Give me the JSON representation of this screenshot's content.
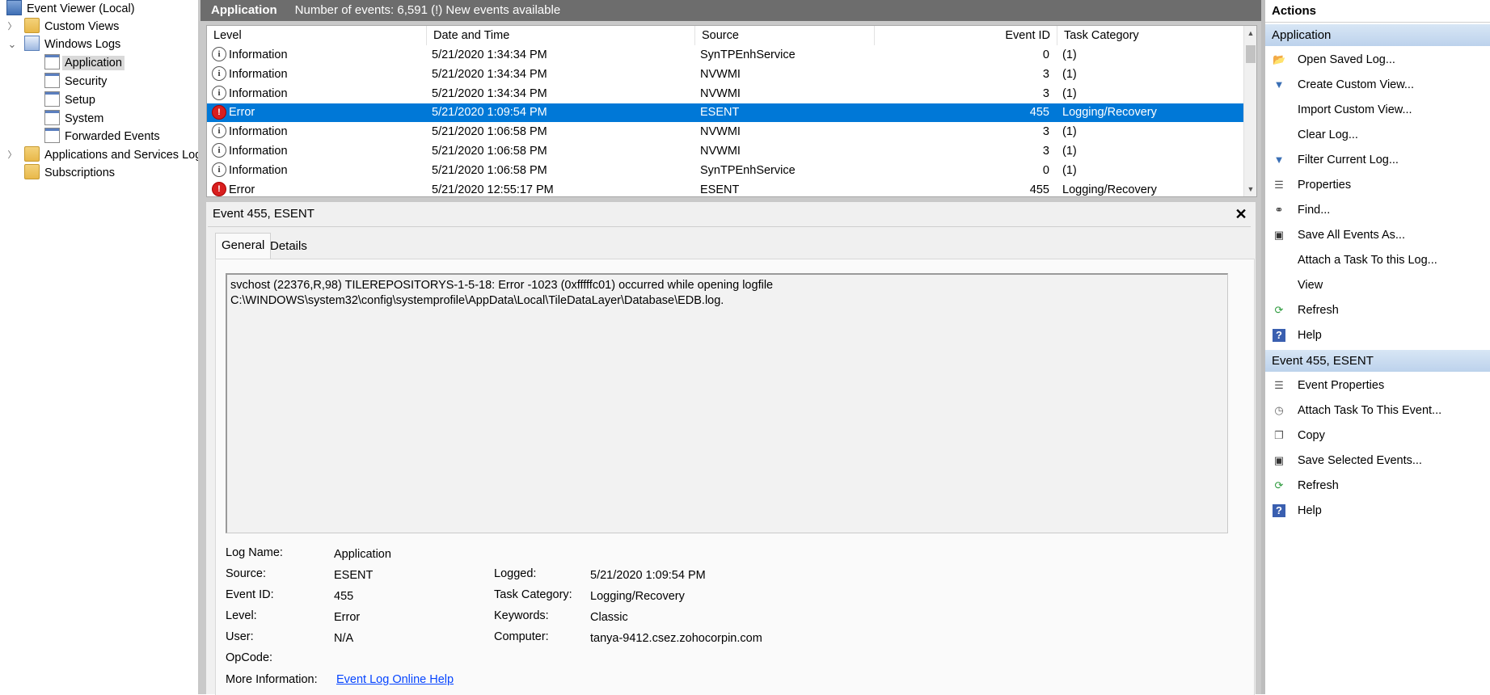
{
  "tree": {
    "items": [
      {
        "label": "Event Viewer (Local)",
        "icon": "event-viewer-icon",
        "expander": ""
      },
      {
        "label": "Custom Views",
        "icon": "folder-icon",
        "expander": "›"
      },
      {
        "label": "Windows Logs",
        "icon": "computer-folder-icon",
        "expander": "⌄"
      },
      {
        "label": "Application",
        "icon": "log-icon",
        "expander": ""
      },
      {
        "label": "Security",
        "icon": "log-icon",
        "expander": ""
      },
      {
        "label": "Setup",
        "icon": "log-icon",
        "expander": ""
      },
      {
        "label": "System",
        "icon": "log-icon",
        "expander": ""
      },
      {
        "label": "Forwarded Events",
        "icon": "log-icon",
        "expander": ""
      },
      {
        "label": "Applications and Services Log",
        "icon": "folder-icon",
        "expander": "›"
      },
      {
        "label": "Subscriptions",
        "icon": "subscriptions-icon",
        "expander": ""
      }
    ]
  },
  "center": {
    "title": "Application",
    "count_text": "Number of events: 6,591 (!) New events available"
  },
  "grid": {
    "columns": [
      "Level",
      "Date and Time",
      "Source",
      "Event ID",
      "Task Category"
    ],
    "rows": [
      {
        "level": "Information",
        "icon": "i",
        "date": "5/21/2020 1:34:34 PM",
        "source": "SynTPEnhService",
        "id": "0",
        "category": "(1)"
      },
      {
        "level": "Information",
        "icon": "i",
        "date": "5/21/2020 1:34:34 PM",
        "source": "NVWMI",
        "id": "3",
        "category": "(1)"
      },
      {
        "level": "Information",
        "icon": "i",
        "date": "5/21/2020 1:34:34 PM",
        "source": "NVWMI",
        "id": "3",
        "category": "(1)"
      },
      {
        "level": "Error",
        "icon": "!",
        "date": "5/21/2020 1:09:54 PM",
        "source": "ESENT",
        "id": "455",
        "category": "Logging/Recovery"
      },
      {
        "level": "Information",
        "icon": "i",
        "date": "5/21/2020 1:06:58 PM",
        "source": "NVWMI",
        "id": "3",
        "category": "(1)"
      },
      {
        "level": "Information",
        "icon": "i",
        "date": "5/21/2020 1:06:58 PM",
        "source": "NVWMI",
        "id": "3",
        "category": "(1)"
      },
      {
        "level": "Information",
        "icon": "i",
        "date": "5/21/2020 1:06:58 PM",
        "source": "SynTPEnhService",
        "id": "0",
        "category": "(1)"
      },
      {
        "level": "Error",
        "icon": "!",
        "date": "5/21/2020 12:55:17 PM",
        "source": "ESENT",
        "id": "455",
        "category": "Logging/Recovery"
      }
    ],
    "selected_row": 3
  },
  "detail": {
    "title": "Event 455, ESENT",
    "close": "✕",
    "tabs": [
      "General",
      "Details"
    ],
    "message": "svchost (22376,R,98) TILEREPOSITORYS-1-5-18: Error -1023 (0xfffffc01) occurred while opening logfile C:\\WINDOWS\\system32\\config\\systemprofile\\AppData\\Local\\TileDataLayer\\Database\\EDB.log.",
    "fields": {
      "log_name_label": "Log Name:",
      "log_name": "Application",
      "source_label": "Source:",
      "source": "ESENT",
      "event_id_label": "Event ID:",
      "event_id": "455",
      "level_label": "Level:",
      "level": "Error",
      "user_label": "User:",
      "user": "N/A",
      "opcode_label": "OpCode:",
      "opcode": "",
      "more_info_label": "More Information:",
      "more_info_link": "Event Log Online Help",
      "logged_label": "Logged:",
      "logged": "5/21/2020 1:09:54 PM",
      "task_label": "Task Category:",
      "task": "Logging/Recovery",
      "keywords_label": "Keywords:",
      "keywords": "Classic",
      "computer_label": "Computer:",
      "computer": "tanya-9412.csez.zohocorpin.com"
    }
  },
  "actions": {
    "title": "Actions",
    "section1": "Application",
    "items1": [
      {
        "label": "Open Saved Log...",
        "icon": "open-folder-icon"
      },
      {
        "label": "Create Custom View...",
        "icon": "filter-icon"
      },
      {
        "label": "Import Custom View...",
        "icon": ""
      },
      {
        "label": "Clear Log...",
        "icon": ""
      },
      {
        "label": "Filter Current Log...",
        "icon": "filter-icon"
      },
      {
        "label": "Properties",
        "icon": "properties-icon"
      },
      {
        "label": "Find...",
        "icon": "binoculars-icon"
      },
      {
        "label": "Save All Events As...",
        "icon": "save-icon"
      },
      {
        "label": "Attach a Task To this Log...",
        "icon": ""
      },
      {
        "label": "View",
        "icon": ""
      },
      {
        "label": "Refresh",
        "icon": "refresh-icon"
      },
      {
        "label": "Help",
        "icon": "help-icon"
      }
    ],
    "section2": "Event 455, ESENT",
    "items2": [
      {
        "label": "Event Properties",
        "icon": "properties-icon"
      },
      {
        "label": "Attach Task To This Event...",
        "icon": "task-icon"
      },
      {
        "label": "Copy",
        "icon": "copy-icon"
      },
      {
        "label": "Save Selected Events...",
        "icon": "save-icon"
      },
      {
        "label": "Refresh",
        "icon": "refresh-icon"
      },
      {
        "label": "Help",
        "icon": "help-icon"
      }
    ]
  },
  "colors": {
    "selection": "#0078d7",
    "header_bar": "#6d6d6d",
    "section_blue": "#c9dbef",
    "link": "#0645ff"
  }
}
